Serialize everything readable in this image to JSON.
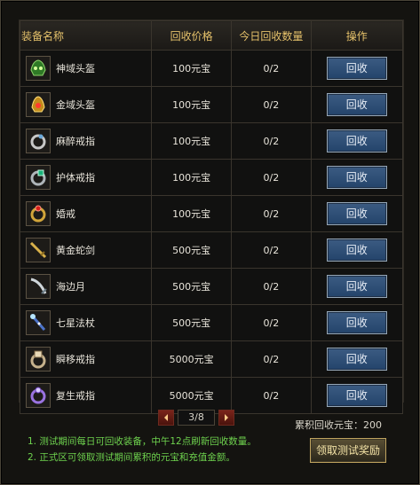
{
  "table": {
    "headers": [
      "装备名称",
      "回收价格",
      "今日回收数量",
      "操作"
    ],
    "rows": [
      {
        "name": "神域头盔",
        "price": "100元宝",
        "count": "0/2",
        "action": "回收",
        "icon": "helmet-green-icon"
      },
      {
        "name": "金域头盔",
        "price": "100元宝",
        "count": "0/2",
        "action": "回收",
        "icon": "helmet-gold-icon"
      },
      {
        "name": "麻醉戒指",
        "price": "100元宝",
        "count": "0/2",
        "action": "回收",
        "icon": "ring-silver-icon"
      },
      {
        "name": "护体戒指",
        "price": "100元宝",
        "count": "0/2",
        "action": "回收",
        "icon": "ring-green-icon"
      },
      {
        "name": "婚戒",
        "price": "100元宝",
        "count": "0/2",
        "action": "回收",
        "icon": "ring-red-icon"
      },
      {
        "name": "黄金蛇剑",
        "price": "500元宝",
        "count": "0/2",
        "action": "回收",
        "icon": "sword-gold-icon"
      },
      {
        "name": "海边月",
        "price": "500元宝",
        "count": "0/2",
        "action": "回收",
        "icon": "blade-moon-icon"
      },
      {
        "name": "七星法杖",
        "price": "500元宝",
        "count": "0/2",
        "action": "回收",
        "icon": "staff-icon"
      },
      {
        "name": "瞬移戒指",
        "price": "5000元宝",
        "count": "0/2",
        "action": "回收",
        "icon": "ring-cube-icon"
      },
      {
        "name": "复生戒指",
        "price": "5000元宝",
        "count": "0/2",
        "action": "回收",
        "icon": "ring-purple-icon"
      }
    ]
  },
  "pagination": {
    "current": "3/8"
  },
  "summary": {
    "total_label": "累积回收元宝：200"
  },
  "notes": [
    "1. 测试期间每日可回收装备，中午12点刷新回收数量。",
    "2. 正式区可领取测试期间累积的元宝和充值金额。"
  ],
  "claim_button": {
    "label": "领取测试奖励"
  },
  "colors": {
    "header_text": "#e6c26b",
    "note_text": "#6ed24e",
    "button_blue": "#2d4f78"
  }
}
